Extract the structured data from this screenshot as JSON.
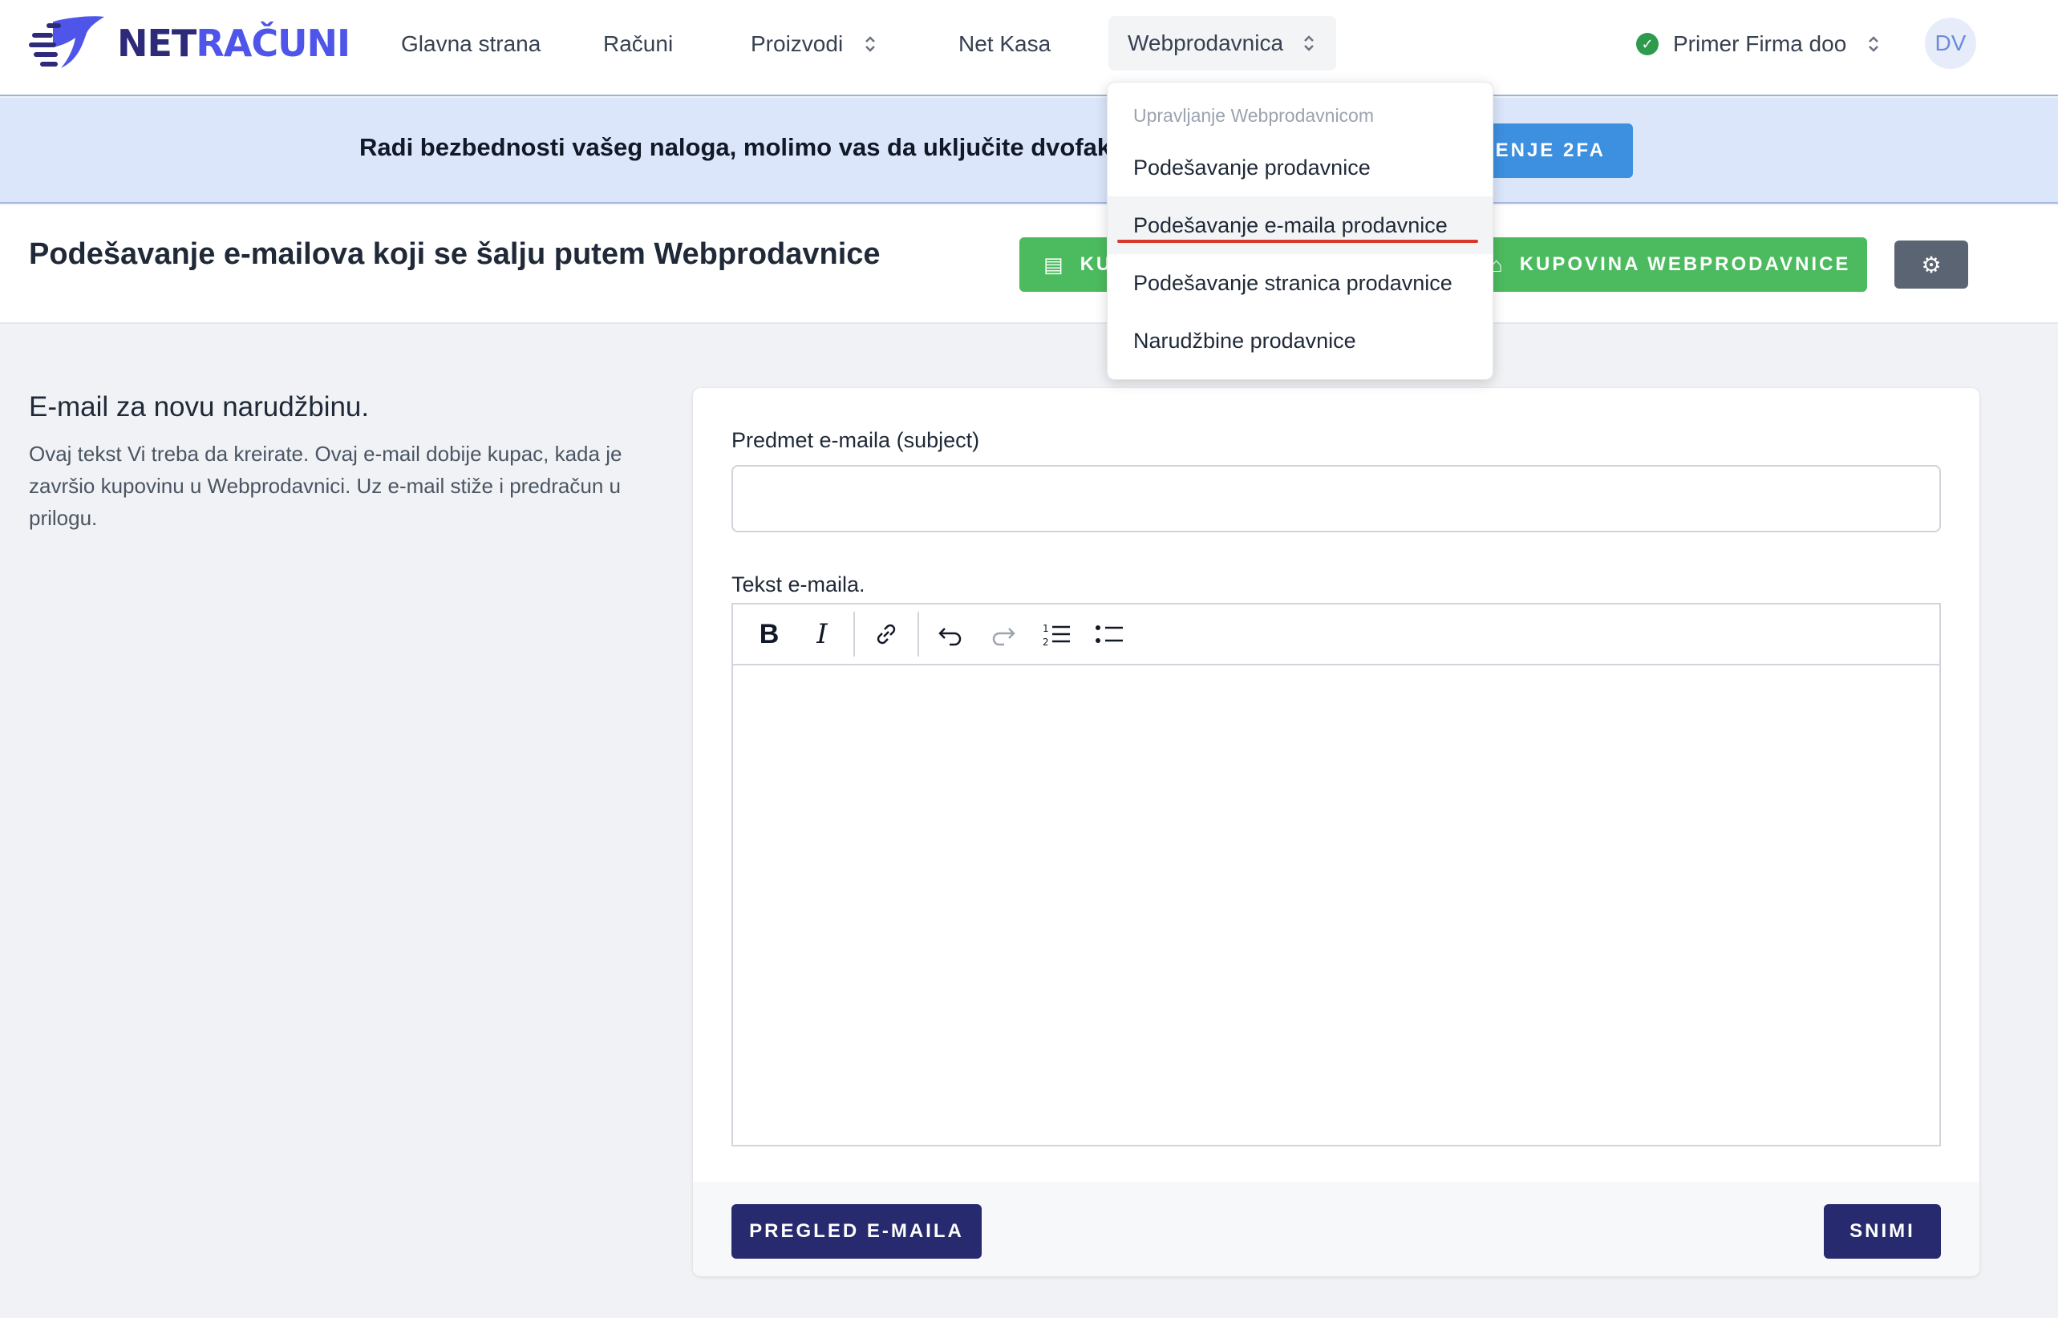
{
  "brand": {
    "name_prefix": "NET",
    "name_suffix": "RAČUNI"
  },
  "nav": {
    "items": [
      {
        "label": "Glavna strana"
      },
      {
        "label": "Računi"
      },
      {
        "label": "Proizvodi"
      },
      {
        "label": "Net Kasa"
      },
      {
        "label": "Webprodavnica"
      }
    ],
    "company": "Primer Firma doo",
    "avatar": "DV"
  },
  "banner": {
    "text": "Radi bezbednosti vašeg naloga, molimo vas da uključite dvofakto",
    "button": "ČENJE 2FA"
  },
  "header": {
    "title": "Podešavanje e-mailova koji se šalju putem Webprodavnice",
    "btn_partial": "KU",
    "btn_shop": "KUPOVINA WEBPRODAVNICE"
  },
  "section": {
    "title": "E-mail za novu narudžbinu.",
    "description": "Ovaj tekst Vi treba da kreirate. Ovaj e-mail dobije kupac, kada je završio kupovinu u Webprodavnici. Uz e-mail stiže i predračun u prilogu."
  },
  "form": {
    "subject_label": "Predmet e-maila (subject)",
    "subject_value": "",
    "body_label": "Tekst e-maila.",
    "preview_button": "PREGLED E-MAILA",
    "save_button": "SNIMI"
  },
  "dropdown": {
    "header": "Upravljanje Webprodavnicom",
    "items": [
      {
        "label": "Podešavanje prodavnice"
      },
      {
        "label": "Podešavanje e-maila prodavnice"
      },
      {
        "label": "Podešavanje stranica prodavnice"
      },
      {
        "label": "Narudžbine prodavnice"
      }
    ]
  },
  "colors": {
    "brand_dark": "#2e2a7a",
    "brand_accent": "#4f55e8",
    "green": "#4cbb5f",
    "primary_dark": "#272a6e",
    "banner_bg": "#dbe6fa",
    "banner_button": "#3d8fe0",
    "highlight_underline": "#d9382b"
  },
  "icons": [
    "logo-icon",
    "chevron-updown-icon",
    "check-circle-icon",
    "document-icon",
    "store-icon",
    "gear-icon",
    "bold-icon",
    "italic-icon",
    "link-icon",
    "undo-icon",
    "redo-icon",
    "ordered-list-icon",
    "bullet-list-icon"
  ]
}
